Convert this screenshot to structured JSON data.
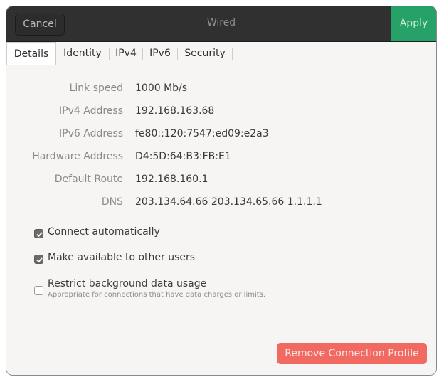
{
  "header": {
    "title": "Wired",
    "cancel_label": "Cancel",
    "apply_label": "Apply"
  },
  "tabs": [
    {
      "label": "Details",
      "active": true
    },
    {
      "label": "Identity",
      "active": false
    },
    {
      "label": "IPv4",
      "active": false
    },
    {
      "label": "IPv6",
      "active": false
    },
    {
      "label": "Security",
      "active": false
    }
  ],
  "details": {
    "link_speed": {
      "label": "Link speed",
      "value": "1000 Mb/s"
    },
    "ipv4": {
      "label": "IPv4 Address",
      "value": "192.168.163.68"
    },
    "ipv6": {
      "label": "IPv6 Address",
      "value": "fe80::120:7547:ed09:e2a3"
    },
    "hardware": {
      "label": "Hardware Address",
      "value": "D4:5D:64:B3:FB:E1"
    },
    "route": {
      "label": "Default Route",
      "value": "192.168.160.1"
    },
    "dns": {
      "label": "DNS",
      "value": "203.134.64.66 203.134.65.66 1.1.1.1"
    }
  },
  "options": {
    "connect_auto": {
      "label": "Connect automatically",
      "checked": true
    },
    "available_users": {
      "label": "Make available to other users",
      "checked": true
    },
    "restrict_bg": {
      "label": "Restrict background data usage",
      "description": "Appropriate for connections that have data charges or limits.",
      "checked": false
    }
  },
  "remove_label": "Remove Connection Profile",
  "colors": {
    "apply": "#26a269",
    "remove": "#f06a61",
    "header": "#303030"
  }
}
